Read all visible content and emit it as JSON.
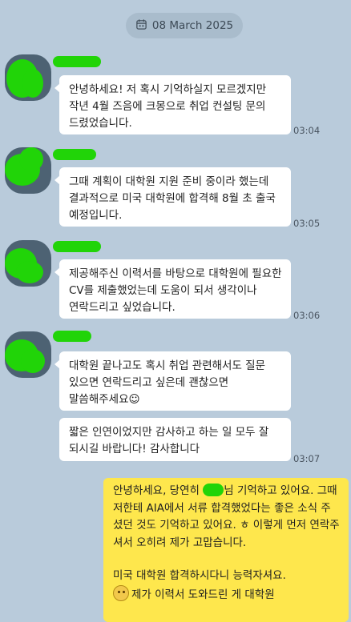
{
  "date_divider": {
    "text": "08 March 2025",
    "icon": "calendar-icon"
  },
  "messages": [
    {
      "text": "안녕하세요! 저 혹시 기억하실지 모르겠지만 작년 4월 즈음에 크몽으로 취업 컨설팅 문의 드렸었습니다.",
      "time": "03:04"
    },
    {
      "text": "그때 계획이 대학원 지원 준비 중이라 했는데 결과적으로 미국 대학원에 합격해 8월 초 출국 예정입니다.",
      "time": "03:05"
    },
    {
      "text": "제공해주신 이력서를 바탕으로 대학원에 필요한 CV를 제출했었는데 도움이 되서 생각이나 연락드리고 싶었습니다.",
      "time": "03:06"
    },
    {
      "text": "대학원 끝나고도 혹시 취업 관련해서도 질문 있으면 연락드리고 싶은데 괜찮으면 말씀해주세요☺",
      "time": ""
    },
    {
      "text": "짧은 인연이었지만 감사하고 하는 일 모두 잘 되시길 바랍니다! 감사합니다",
      "time": "03:07"
    }
  ],
  "reply": {
    "line1_before": "안녕하세요, 당연히 ",
    "line1_after": "님 기억하고 있어요. 그때 저한테 AIA에서 서류 합격했었다는 좋은 소식 주셨던 것도 기억하고 있어요. ㅎ 이렇게 먼저 연락주셔서 오히려 제가 고맙습니다.",
    "line2": "미국 대학원 합격하시다니 능력자셔요.",
    "line3": "제가 이력서 도와드린 게 대학원"
  }
}
